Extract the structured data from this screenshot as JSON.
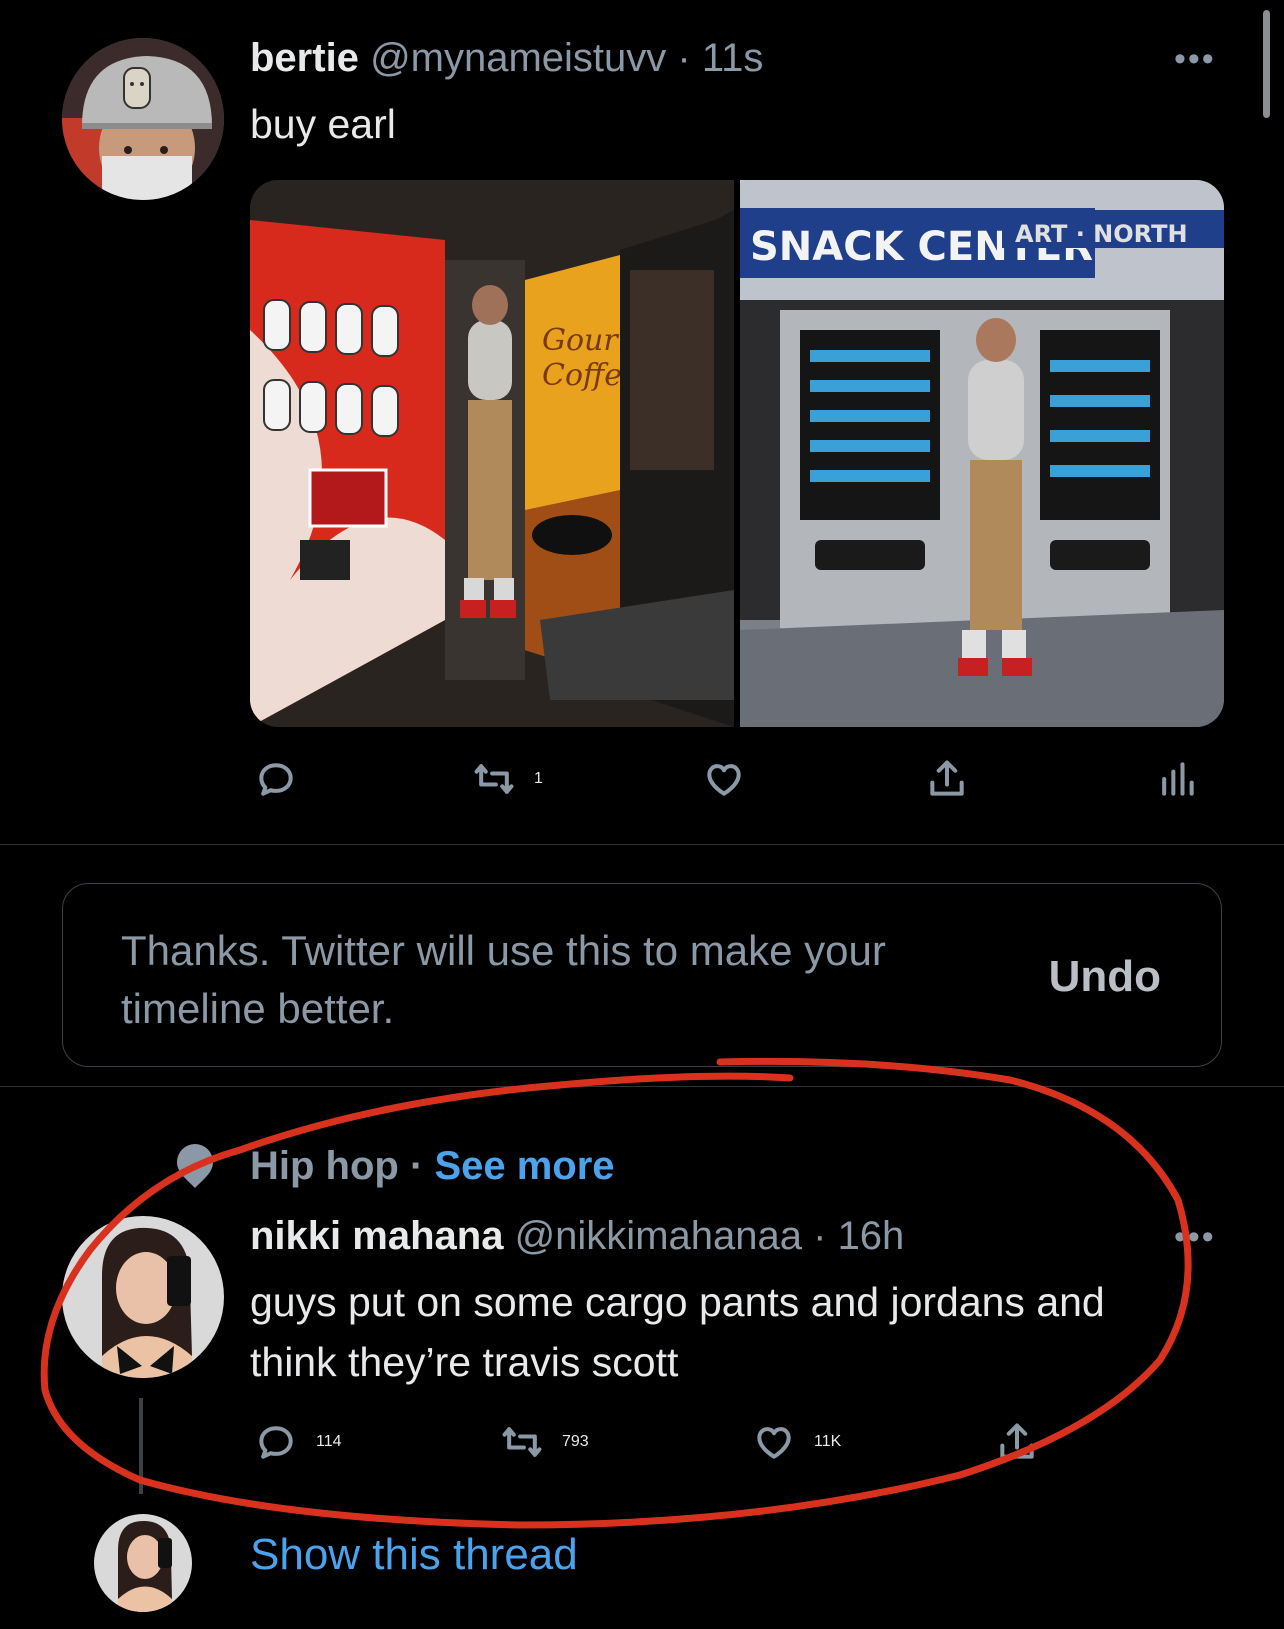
{
  "tweet1": {
    "name": "bertie",
    "handle": "@mynameistuvv",
    "dot": "·",
    "time": "11s",
    "text": "buy earl",
    "more_icon": "more-horizontal-icon",
    "photo_left": {
      "coffee_line1": "Gourmet",
      "coffee_line2": "Coffee"
    },
    "photo_right": {
      "sign": "SNACK CENTER",
      "sign2": "ART · NORTH"
    },
    "actions": {
      "reply_count": "",
      "retweet_count": "1",
      "like_count": "",
      "icons": [
        "reply-icon",
        "retweet-icon",
        "like-icon",
        "share-icon",
        "analytics-icon"
      ]
    }
  },
  "notice": {
    "text": "Thanks. Twitter will use this to make your timeline better.",
    "undo_label": "Undo"
  },
  "tweet2": {
    "social_context": "Hip hop",
    "social_dot": "·",
    "see_more": "See more",
    "name": "nikki mahana",
    "handle": "@nikkimahanaa",
    "dot": "·",
    "time": "16h",
    "text": "guys put on some cargo pants and jordans and think they’re travis scott",
    "actions": {
      "reply_count": "114",
      "retweet_count": "793",
      "like_count": "11K"
    }
  },
  "thread": {
    "show_thread": "Show this thread"
  },
  "colors": {
    "background": "#000000",
    "text": "#e7e9ea",
    "secondary": "#8b98a5",
    "link": "#4ba3ee",
    "annotation": "#d8321f"
  }
}
